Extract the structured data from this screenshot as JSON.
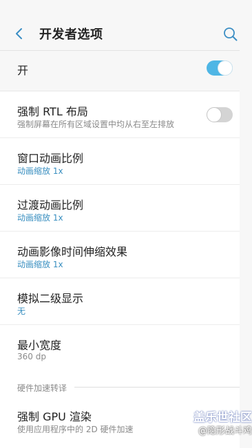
{
  "header": {
    "title": "开发者选项"
  },
  "master": {
    "label": "开",
    "state": "on"
  },
  "settings": [
    {
      "label": "强制 RTL 布局",
      "subtitle": "强制屏幕在所有区域设置中均从右至左排放",
      "subtitle_style": "gray",
      "toggle": "off"
    },
    {
      "label": "窗口动画比例",
      "subtitle": "动画缩放 1x",
      "subtitle_style": "blue"
    },
    {
      "label": "过渡动画比例",
      "subtitle": "动画缩放 1x",
      "subtitle_style": "blue"
    },
    {
      "label": "动画影像时间伸缩效果",
      "subtitle": "动画缩放 1x",
      "subtitle_style": "blue"
    },
    {
      "label": "模拟二级显示",
      "subtitle": "无",
      "subtitle_style": "blue"
    },
    {
      "label": "最小宽度",
      "subtitle": "360 dp",
      "subtitle_style": "gray"
    }
  ],
  "section": {
    "title": "硬件加速转译"
  },
  "section_items": [
    {
      "label": "强制 GPU 渲染",
      "subtitle": "使用应用程序中的 2D 硬件加速",
      "subtitle_style": "gray"
    }
  ],
  "watermark": {
    "line1": "盖乐世社区",
    "line2": "@隐形战斗鸡"
  },
  "colors": {
    "accent": "#4fb6e5",
    "link": "#3a8fc0",
    "background": "#f7f7f7"
  },
  "icons": {
    "back": "chevron-left-icon",
    "search": "search-icon"
  }
}
